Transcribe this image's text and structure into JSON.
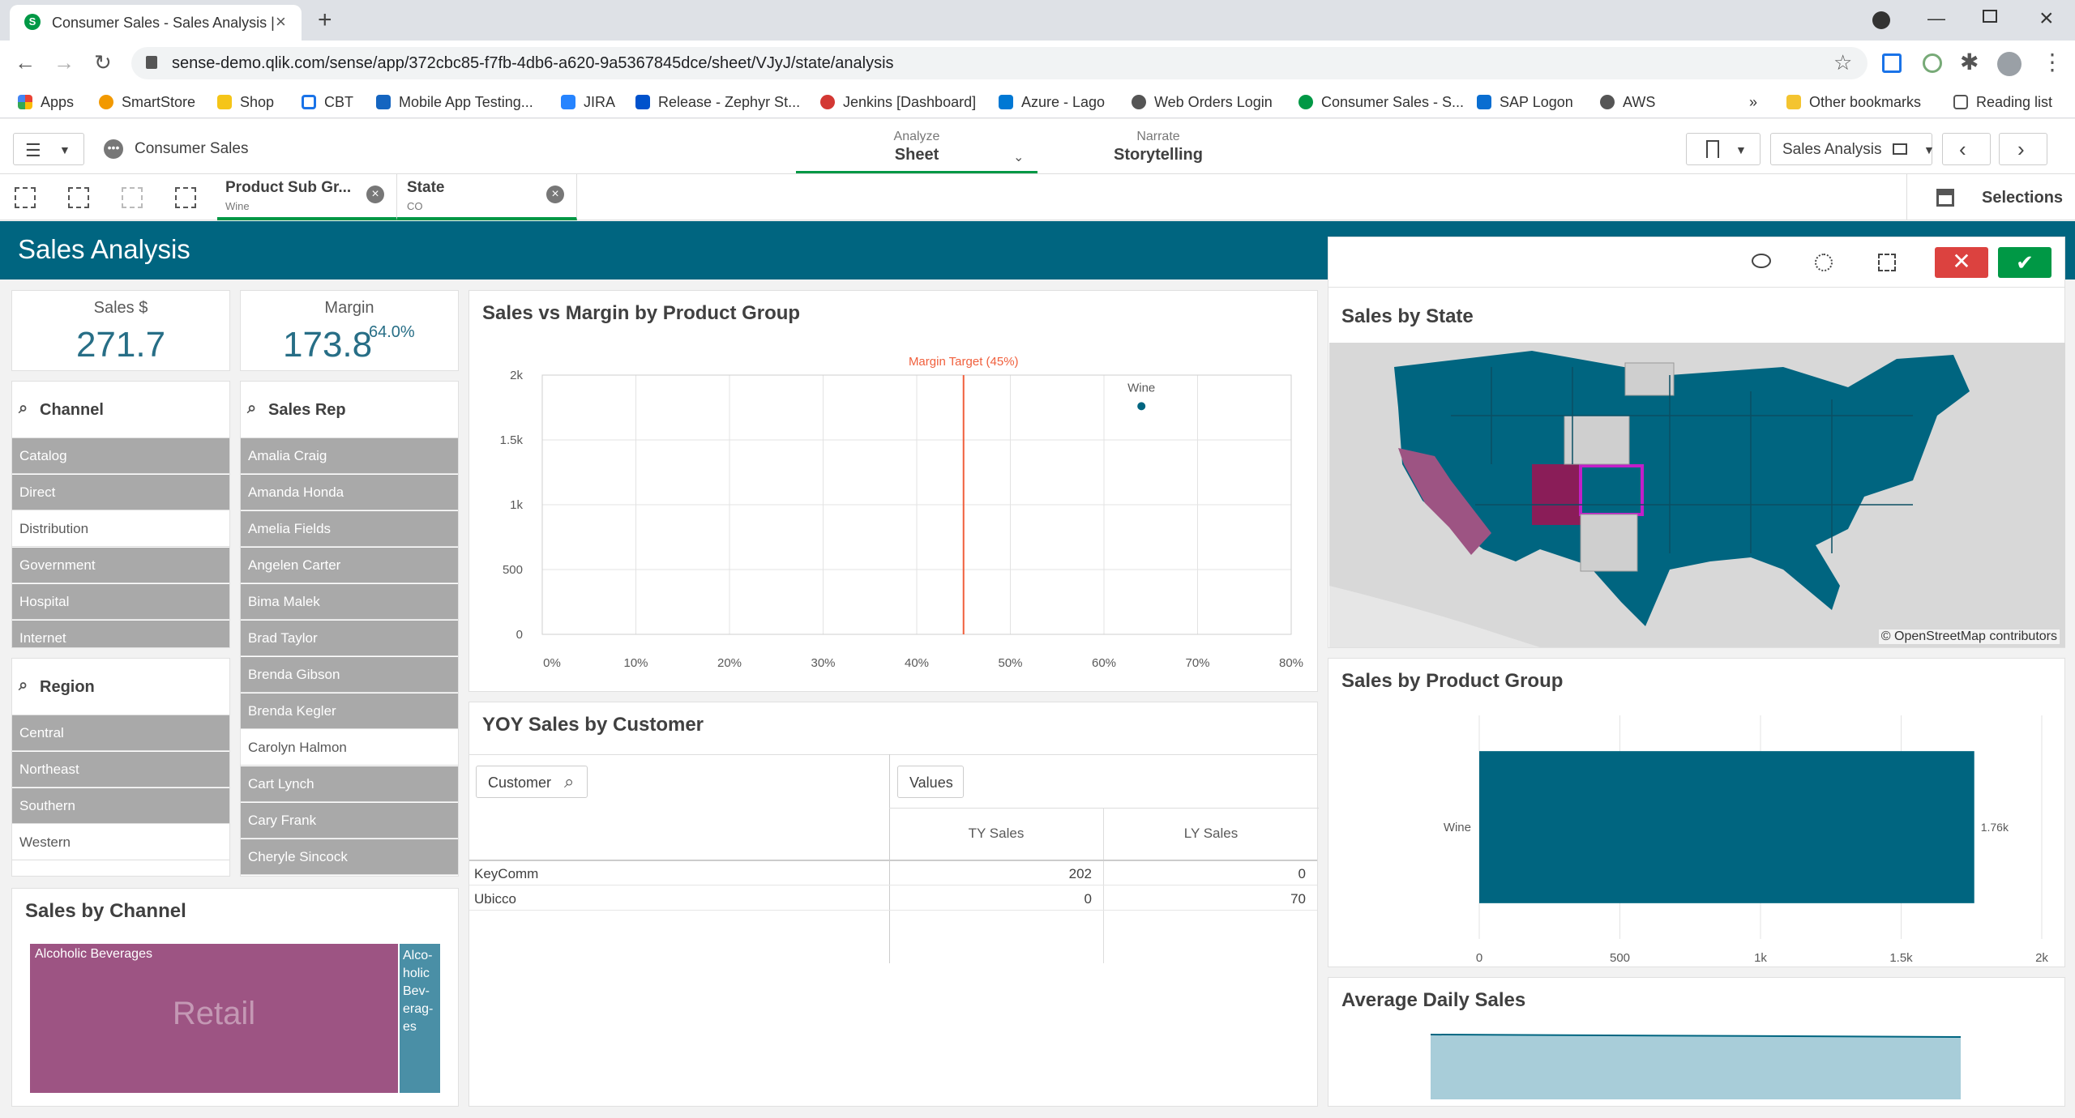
{
  "browser": {
    "tab_title": "Consumer Sales - Sales Analysis |",
    "url": "sense-demo.qlik.com/sense/app/372cbc85-f7fb-4db6-a620-9a5367845dce/sheet/VJyJ/state/analysis"
  },
  "bookmarks": [
    "Apps",
    "SmartStore",
    "Shop",
    "CBT",
    "Mobile App Testing...",
    "JIRA",
    "Release - Zephyr St...",
    "Jenkins [Dashboard]",
    "Azure - Lago",
    "Web Orders Login",
    "Consumer Sales - S...",
    "SAP Logon",
    "AWS"
  ],
  "bookmarks_more": "»",
  "other_bookmarks": "Other bookmarks",
  "reading_list": "Reading list",
  "app": {
    "name": "Consumer Sales",
    "analyze_label": "Analyze",
    "analyze_value": "Sheet",
    "narrate_label": "Narrate",
    "narrate_value": "Storytelling",
    "sheet_name": "Sales Analysis",
    "selections_label": "Selections"
  },
  "selections": [
    {
      "field": "Product Sub Gr...",
      "value": "Wine"
    },
    {
      "field": "State",
      "value": "CO"
    }
  ],
  "sheet_title": "Sales Analysis",
  "kpis": {
    "sales_label": "Sales $",
    "sales_value": "271.7",
    "margin_label": "Margin",
    "margin_value": "173.8",
    "margin_pct": "64.0%"
  },
  "channel": {
    "title": "Channel",
    "items": [
      {
        "label": "Catalog",
        "state": "excluded"
      },
      {
        "label": "Direct",
        "state": "excluded"
      },
      {
        "label": "Distribution",
        "state": "possible"
      },
      {
        "label": "Government",
        "state": "excluded"
      },
      {
        "label": "Hospital",
        "state": "excluded"
      },
      {
        "label": "Internet",
        "state": "excluded"
      }
    ]
  },
  "region": {
    "title": "Region",
    "items": [
      {
        "label": "Central",
        "state": "excluded"
      },
      {
        "label": "Northeast",
        "state": "excluded"
      },
      {
        "label": "Southern",
        "state": "excluded"
      },
      {
        "label": "Western",
        "state": "possible"
      }
    ]
  },
  "salesrep": {
    "title": "Sales Rep",
    "items": [
      {
        "label": "Amalia Craig",
        "state": "excluded"
      },
      {
        "label": "Amanda Honda",
        "state": "excluded"
      },
      {
        "label": "Amelia Fields",
        "state": "excluded"
      },
      {
        "label": "Angelen Carter",
        "state": "excluded"
      },
      {
        "label": "Bima Malek",
        "state": "excluded"
      },
      {
        "label": "Brad Taylor",
        "state": "excluded"
      },
      {
        "label": "Brenda Gibson",
        "state": "excluded"
      },
      {
        "label": "Brenda Kegler",
        "state": "excluded"
      },
      {
        "label": "Carolyn Halmon",
        "state": "possible"
      },
      {
        "label": "Cart Lynch",
        "state": "excluded"
      },
      {
        "label": "Cary Frank",
        "state": "excluded"
      },
      {
        "label": "Cheryle Sincock",
        "state": "excluded"
      }
    ]
  },
  "scatter_title": "Sales vs Margin by Product Group",
  "scatter_refline": "Margin Target (45%)",
  "yoy": {
    "title": "YOY Sales by Customer",
    "dim_btn": "Customer",
    "values_btn": "Values",
    "col1": "TY Sales",
    "col2": "LY Sales",
    "rows": [
      {
        "name": "KeyComm",
        "ty": "202",
        "ly": "0"
      },
      {
        "name": "Ubicco",
        "ty": "0",
        "ly": "70"
      }
    ]
  },
  "treemap": {
    "title": "Sales by Channel",
    "big_label": "Retail",
    "cell1": "Alcoholic Beverages",
    "cell2": "Alco-holic Bev-erag-es"
  },
  "map": {
    "title": "Sales by State",
    "attribution": "© OpenStreetMap contributors"
  },
  "bar_title": "Sales by Product Group",
  "avg_title": "Average Daily Sales",
  "colors": {
    "teal": "#006580",
    "excluded": "#a9a9a9",
    "selected": "#009845",
    "cancel": "#dc423f",
    "refline": "#f05f3c"
  },
  "chart_data": [
    {
      "type": "scatter",
      "title": "Sales vs Margin by Product Group",
      "x_tick_labels": [
        "0%",
        "10%",
        "20%",
        "30%",
        "40%",
        "50%",
        "60%",
        "70%",
        "80%"
      ],
      "y_tick_labels": [
        "0",
        "500",
        "1k",
        "1.5k",
        "2k"
      ],
      "xlim": [
        0,
        0.8
      ],
      "ylim": [
        0,
        2000
      ],
      "points": [
        {
          "label": "Wine",
          "x": 0.64,
          "y": 1760
        }
      ],
      "reference_line": {
        "x": 0.45,
        "label": "Margin Target (45%)"
      },
      "grid": true
    },
    {
      "type": "bar",
      "orientation": "horizontal",
      "title": "Sales by Product Group",
      "categories": [
        "Wine"
      ],
      "values": [
        1760
      ],
      "value_labels": [
        "1.76k"
      ],
      "x_tick_labels": [
        "0",
        "500",
        "1k",
        "1.5k",
        "2k"
      ],
      "xlim": [
        0,
        2000
      ],
      "grid": true
    }
  ]
}
